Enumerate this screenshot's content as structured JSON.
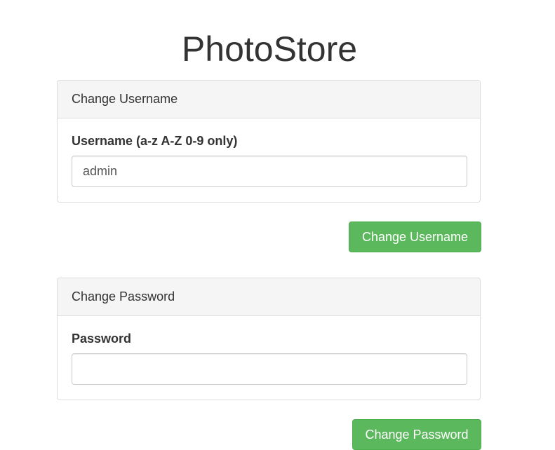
{
  "app": {
    "title": "PhotoStore"
  },
  "username_panel": {
    "heading": "Change Username",
    "label": "Username (a-z A-Z 0-9 only)",
    "value": "admin",
    "button_label": "Change Username"
  },
  "password_panel": {
    "heading": "Change Password",
    "label": "Password",
    "value": "",
    "button_label": "Change Password"
  },
  "colors": {
    "button_bg": "#5cb85c",
    "panel_heading_bg": "#f5f5f5",
    "text": "#333333"
  }
}
